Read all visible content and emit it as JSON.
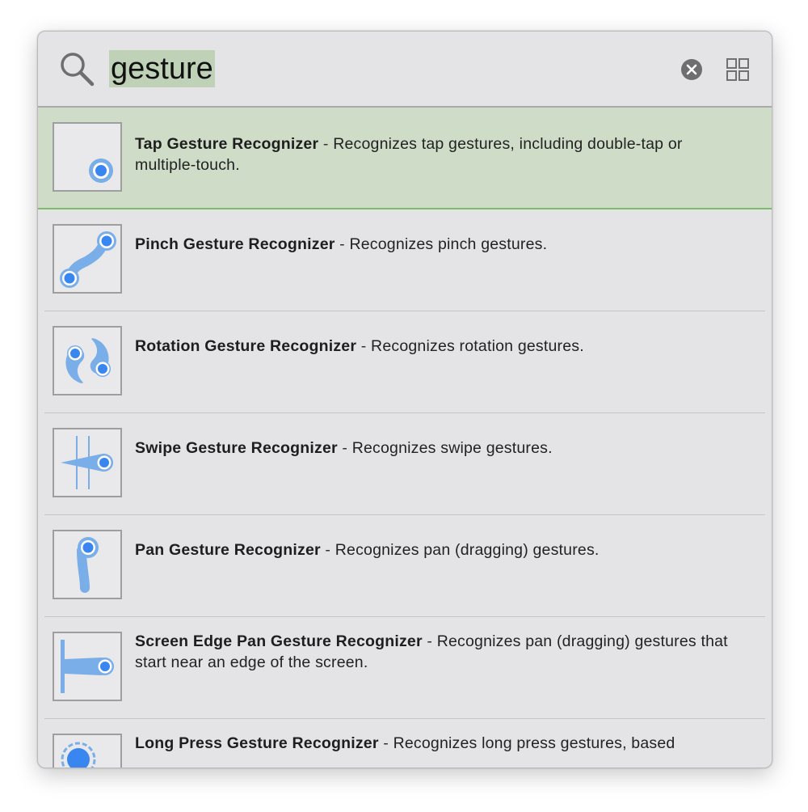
{
  "search": {
    "query": "gesture"
  },
  "icons": {
    "search": "search-icon",
    "clear": "clear-icon",
    "grid": "grid-view-icon"
  },
  "colors": {
    "accent_blue": "#3a86f0",
    "icon_blue": "#7aaee8",
    "selection_bg": "#cedcc8",
    "selection_border": "#7cbc6a",
    "search_highlight": "#bfd2b8"
  },
  "items": [
    {
      "name": "Tap Gesture Recognizer",
      "separator": " - ",
      "description": "Recognizes tap gestures, including double-tap or multiple-touch.",
      "icon": "tap-gesture-icon",
      "selected": true
    },
    {
      "name": "Pinch Gesture Recognizer",
      "separator": " - ",
      "description": "Recognizes pinch gestures.",
      "icon": "pinch-gesture-icon",
      "selected": false
    },
    {
      "name": "Rotation Gesture Recognizer",
      "separator": " - ",
      "description": "Recognizes rotation gestures.",
      "icon": "rotation-gesture-icon",
      "selected": false
    },
    {
      "name": "Swipe Gesture Recognizer",
      "separator": " - ",
      "description": "Recognizes swipe gestures.",
      "icon": "swipe-gesture-icon",
      "selected": false
    },
    {
      "name": "Pan Gesture Recognizer",
      "separator": " - ",
      "description": "Recognizes pan (dragging) gestures.",
      "icon": "pan-gesture-icon",
      "selected": false
    },
    {
      "name": "Screen Edge Pan Gesture Recognizer",
      "separator": " - ",
      "description": "Recognizes pan (dragging) gestures that start near an edge of the screen.",
      "icon": "screen-edge-pan-gesture-icon",
      "selected": false
    },
    {
      "name": "Long Press Gesture Recognizer",
      "separator": " - ",
      "description": "Recognizes long press gestures, based",
      "icon": "long-press-gesture-icon",
      "selected": false
    }
  ]
}
